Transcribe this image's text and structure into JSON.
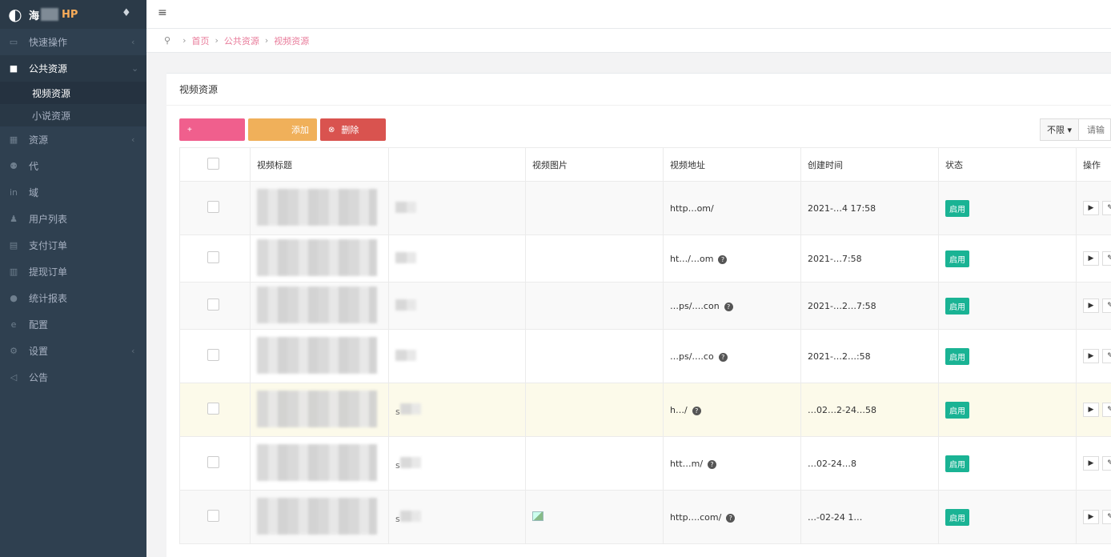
{
  "brand": {
    "logo_text": "海",
    "suffix": "HP"
  },
  "sidebar": {
    "items": [
      {
        "label": "快速操作",
        "icon": "folder-icon",
        "glyph": "▭",
        "has_arrow": true
      },
      {
        "label": "公共资源",
        "icon": "video-camera-icon",
        "glyph": "■",
        "has_arrow": true,
        "active": true
      },
      {
        "label": "资源",
        "icon": "grid-icon",
        "glyph": "▦",
        "has_arrow": true
      },
      {
        "label": "代",
        "icon": "users-icon",
        "glyph": "⚉",
        "has_arrow": false
      },
      {
        "label": "域",
        "icon": "linkedin-icon",
        "glyph": "in",
        "has_arrow": false
      },
      {
        "label": "用户列表",
        "icon": "user-icon",
        "glyph": "♟",
        "has_arrow": false
      },
      {
        "label": "支付订单",
        "icon": "list-icon",
        "glyph": "▤",
        "has_arrow": false
      },
      {
        "label": "提现订单",
        "icon": "bank-icon",
        "glyph": "▥",
        "has_arrow": false
      },
      {
        "label": "统计报表",
        "icon": "info-icon",
        "glyph": "●",
        "has_arrow": false
      },
      {
        "label": "配置",
        "icon": "edge-icon",
        "glyph": "e",
        "has_arrow": false
      },
      {
        "label": "设置",
        "icon": "gear-icon",
        "glyph": "⚙",
        "has_arrow": true
      },
      {
        "label": "公告",
        "icon": "bullhorn-icon",
        "glyph": "◁",
        "has_arrow": false
      }
    ],
    "subitems": [
      {
        "label": "视频资源",
        "active": true
      },
      {
        "label": "小说资源",
        "active": false
      }
    ]
  },
  "topbar": {
    "menu_icon": "≡"
  },
  "breadcrumb": {
    "pin": "⚲",
    "sep": "›",
    "items": [
      "首页",
      "公共资源",
      "视频资源"
    ]
  },
  "panel": {
    "title": "视频资源"
  },
  "toolbar": {
    "buttons": [
      {
        "label": "",
        "icon": "+",
        "style": "pink"
      },
      {
        "label": "添加",
        "icon": "",
        "style": "orange"
      },
      {
        "label": "删除",
        "icon": "⊗",
        "style": "red"
      }
    ]
  },
  "filter": {
    "select_value": "不限 ▾",
    "search_placeholder": "请输"
  },
  "table": {
    "headers": [
      "",
      "视频标题",
      "",
      "视频图片",
      "视频地址",
      "创建时间",
      "状态",
      "操作"
    ],
    "rows": [
      {
        "col2": "",
        "url": "http…om/",
        "help": false,
        "time": "2021-…4 17:58",
        "status": "启用",
        "img": false,
        "style": "alt"
      },
      {
        "col2": "",
        "url": "ht…/…om",
        "help": true,
        "time": "2021-…7:58",
        "status": "启用",
        "img": false,
        "style": ""
      },
      {
        "col2": "",
        "url": "…ps/….con",
        "help": true,
        "time": "2021-…2…7:58",
        "status": "启用",
        "img": false,
        "style": "alt"
      },
      {
        "col2": "",
        "url": "…ps/….co",
        "help": true,
        "time": "2021-…2…:58",
        "status": "启用",
        "img": false,
        "style": ""
      },
      {
        "col2": "s",
        "url": "h…/",
        "help": true,
        "time": "…02…2-24…58",
        "status": "启用",
        "img": false,
        "style": "hl"
      },
      {
        "col2": "s",
        "url": "htt…m/",
        "help": true,
        "time": "…02-24…8",
        "status": "启用",
        "img": false,
        "style": ""
      },
      {
        "col2": "s",
        "url": "http….com/",
        "help": true,
        "time": "…-02-24 1…",
        "status": "启用",
        "img": true,
        "style": "alt"
      }
    ],
    "op_play": "▶",
    "op_edit": "✎"
  }
}
